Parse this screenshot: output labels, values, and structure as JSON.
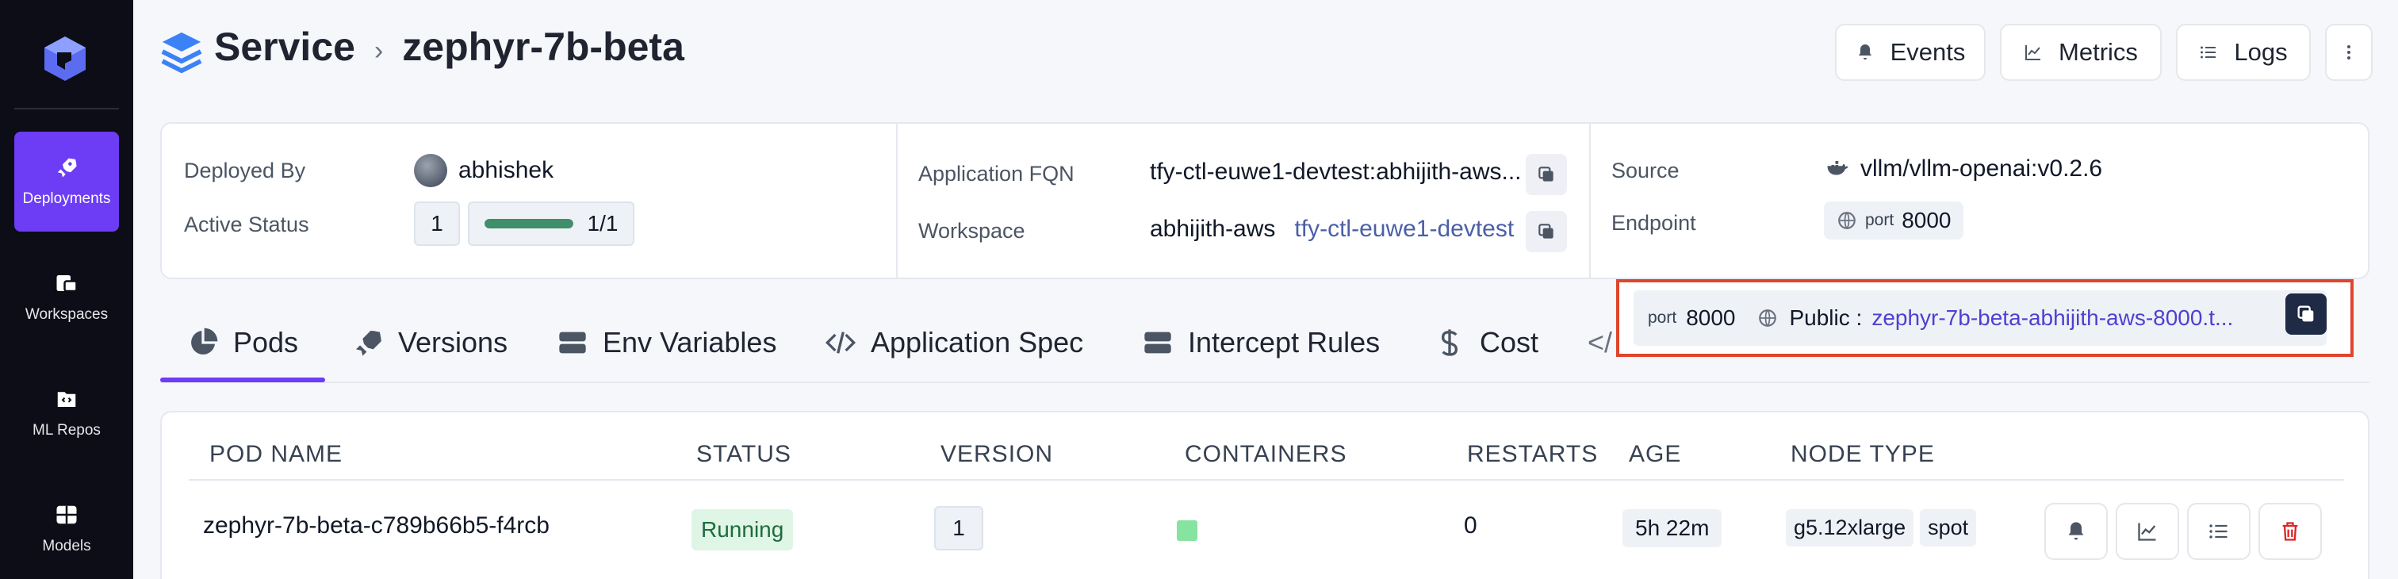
{
  "sidebar": {
    "items": [
      {
        "label": "Deployments",
        "icon": "rocket-icon",
        "active": true
      },
      {
        "label": "Workspaces",
        "icon": "workspaces-icon"
      },
      {
        "label": "ML Repos",
        "icon": "repo-icon"
      },
      {
        "label": "Models",
        "icon": "models-icon"
      }
    ]
  },
  "header": {
    "title": "Service",
    "separator": "›",
    "service_name": "zephyr-7b-beta",
    "buttons": {
      "events": "Events",
      "metrics": "Metrics",
      "logs": "Logs"
    }
  },
  "info": {
    "deployed_by_label": "Deployed By",
    "deployed_by": "abhishek",
    "active_status_label": "Active Status",
    "active_count": "1",
    "active_ratio_text": "1/1",
    "active_ratio": 1.0,
    "fqn_label": "Application FQN",
    "fqn": "tfy-ctl-euwe1-devtest:abhijith-aws...",
    "workspace_label": "Workspace",
    "workspace": "abhijith-aws",
    "workspace_cluster": "tfy-ctl-euwe1-devtest",
    "source_label": "Source",
    "source": "vllm/vllm-openai:v0.2.6",
    "endpoint_label": "Endpoint",
    "endpoint_port_label": "port",
    "endpoint_port": "8000"
  },
  "popup": {
    "port_label": "port",
    "port": "8000",
    "visibility": "Public :",
    "url": "zephyr-7b-beta-abhijith-aws-8000.t..."
  },
  "tabs": [
    {
      "label": "Pods",
      "icon": "pie-chart-icon",
      "active": true
    },
    {
      "label": "Versions",
      "icon": "rocket-icon"
    },
    {
      "label": "Env Variables",
      "icon": "server-icon"
    },
    {
      "label": "Application Spec",
      "icon": "code-icon"
    },
    {
      "label": "Intercept Rules",
      "icon": "server-icon"
    },
    {
      "label": "Cost",
      "icon": "dollar-icon"
    },
    {
      "label": "</",
      "icon": "code-icon"
    }
  ],
  "table": {
    "columns": [
      "POD NAME",
      "STATUS",
      "VERSION",
      "CONTAINERS",
      "RESTARTS",
      "AGE",
      "NODE TYPE"
    ],
    "rows": [
      {
        "pod_name": "zephyr-7b-beta-c789b66b5-f4rcb",
        "status": "Running",
        "version": "1",
        "restarts": "0",
        "age": "5h 22m",
        "node_type": "g5.12xlarge",
        "capacity": "spot"
      }
    ]
  },
  "colors": {
    "accent": "#6d3cf5",
    "sidebar": "#0c0d16",
    "highlight": "#e0452c"
  }
}
